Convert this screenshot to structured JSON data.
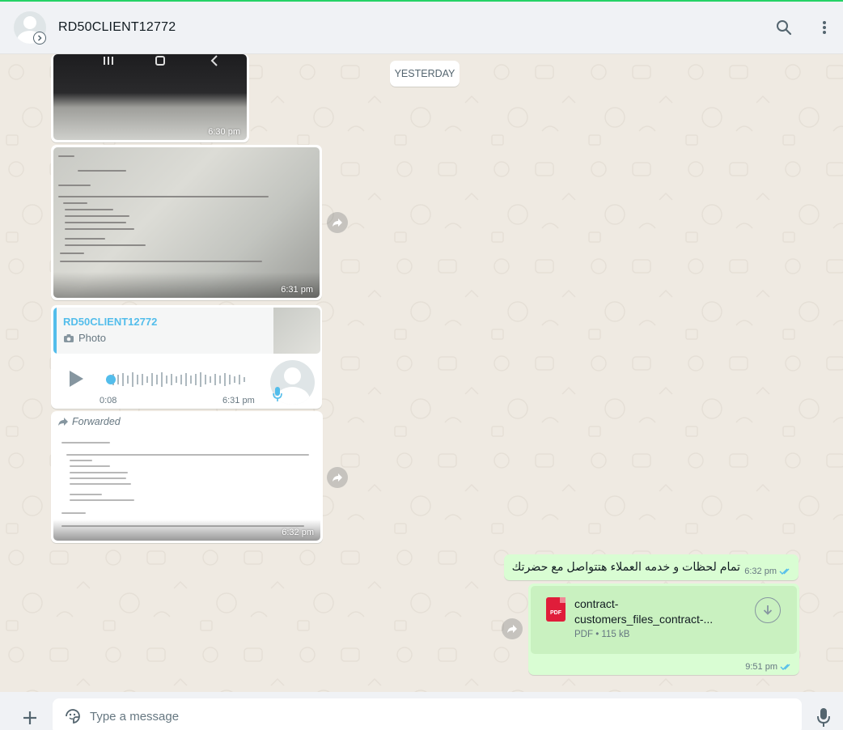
{
  "header": {
    "contact_name": "RD50CLIENT12772",
    "search_icon": "search-icon",
    "menu_icon": "kebab-menu-icon"
  },
  "chat": {
    "date_chip": "YESTERDAY",
    "messages": [
      {
        "type": "image",
        "time": "6:30 pm"
      },
      {
        "type": "image",
        "time": "6:31 pm"
      },
      {
        "type": "voice",
        "quote_name": "RD50CLIENT12772",
        "quote_kind": "Photo",
        "duration": "0:08",
        "time": "6:31 pm"
      },
      {
        "type": "image",
        "forwarded_label": "Forwarded",
        "time": "6:32 pm"
      },
      {
        "type": "text",
        "direction": "out",
        "text": "تمام لحظات و خدمه العملاء هتتواصل مع حضرتك",
        "time": "6:32 pm"
      },
      {
        "type": "document",
        "direction": "out",
        "file_name_line1": "contract-",
        "file_name_line2": "customers_files_contract-...",
        "file_badge": "PDF",
        "file_meta": "PDF • 115 kB",
        "time": "9:51 pm"
      }
    ]
  },
  "composer": {
    "placeholder": "Type a message"
  },
  "colors": {
    "accent": "#25d366",
    "outgoing_bubble": "#d9fdd3",
    "quote_accent": "#53bdeb",
    "read_ticks": "#53bdeb",
    "pdf_red": "#e01d3a"
  }
}
